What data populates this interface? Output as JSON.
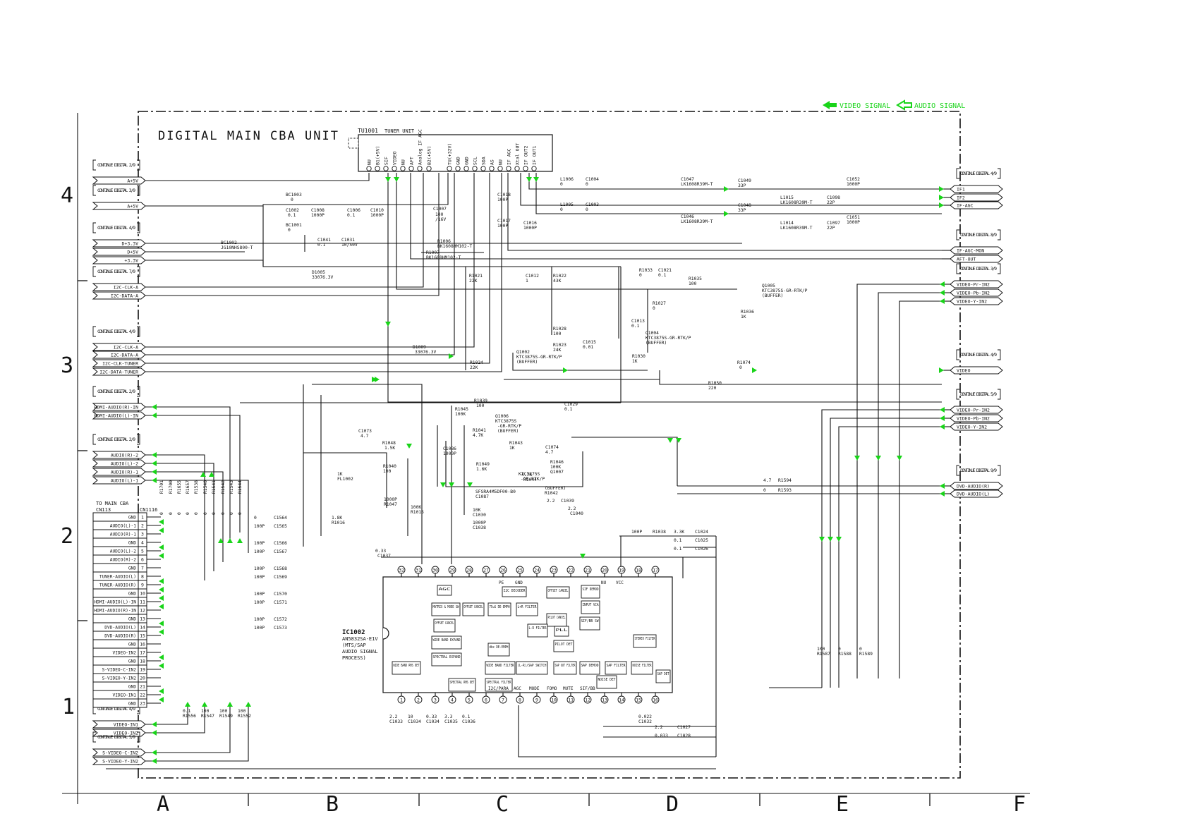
{
  "header": {
    "title": "DIGITAL MAIN CBA UNIT",
    "legend_video": "VIDEO SIGNAL",
    "legend_audio": "AUDIO SIGNAL"
  },
  "colors": {
    "signal_arrow": "#19d419",
    "line": "#111111"
  },
  "grid": {
    "columns": [
      "A",
      "B",
      "C",
      "D",
      "E",
      "F"
    ],
    "rows": [
      "4",
      "3",
      "2",
      "1"
    ]
  },
  "tuner": {
    "ref": "TU1001",
    "name": "TUNER UNIT",
    "pins": [
      "NU",
      "B1(+5V)",
      "SIF",
      "VIDEO",
      "NU",
      "AFT",
      "Analog IF AGC",
      "B2(+5V)",
      "TU(+32V)",
      "GND",
      "GND",
      "SCL",
      "SDA",
      "AS",
      "NU",
      "IF AGC",
      "Xtal OUT",
      "IF OUT2",
      "IF OUT1"
    ]
  },
  "left_connectors": [
    {
      "cont": "CONTINUE DIGITAL 2/9",
      "labels": [
        "A+5V"
      ]
    },
    {
      "cont": "CONTINUE DIGITAL 3/9",
      "labels": [
        "A+5V"
      ]
    },
    {
      "cont": "CONTINUE DIGITAL 4/9",
      "labels": [
        "D+3.3V",
        "D+5V",
        "+3.3V"
      ]
    },
    {
      "cont": "CONTINUE DIGITAL 7/9",
      "labels": [
        "I2C-CLK-A",
        "I2C-DATA-A"
      ]
    },
    {
      "cont": "CONTINUE DIGITAL 4/9",
      "labels": [
        "I2C-CLK-A",
        "I2C-DATA-A",
        "I2C-CLK-TUNER",
        "I2C-DATA-TUNER"
      ]
    },
    {
      "cont": "CONTINUE DIGITAL 2/9",
      "labels": [
        "HDMI-AUDIO(R)-IN",
        "HDMI-AUDIO(L)-IN"
      ]
    },
    {
      "cont": "CONTINUE DIGITAL 2/9",
      "labels": [
        "AUDIO(R)-2",
        "AUDIO(L)-2",
        "AUDIO(R)-1",
        "AUDIO(L)-1"
      ]
    },
    {
      "cont": "CONTINUE DIGITAL 4/9",
      "labels": [
        "VIDEO-IN1",
        "VIDEO-IN2"
      ]
    },
    {
      "cont": "CONTINUE DIGITAL 5/9",
      "labels": [
        "S-VIDEO-C-IN2",
        "S-VIDEO-Y-IN2"
      ]
    }
  ],
  "right_connectors": [
    {
      "cont": "CONTINUE DIGITAL 4/9",
      "labels": [
        "IF1",
        "IF2",
        "IF-AGC"
      ]
    },
    {
      "cont": "CONTINUE DIGITAL 8/9",
      "labels": [
        "IF-AGC-MON",
        "AFT-OUT"
      ]
    },
    {
      "cont": "CONTINUE DIGITAL 3/9",
      "labels": [
        "VIDEO-Pr-IN2",
        "VIDEO-Pb-IN2",
        "VIDEO-Y-IN2"
      ]
    },
    {
      "cont": "CONTINUE DIGITAL 4/9",
      "labels": [
        "VIDEO"
      ]
    },
    {
      "cont": "CONTINUE DIGITAL 5/9",
      "labels": [
        "VIDEO-Pr-IN2",
        "VIDEO-Pb-IN2",
        "VIDEO-Y-IN2"
      ]
    },
    {
      "cont": "CONTINUE DIGITAL 9/9",
      "labels": [
        "DVD-AUDIO(R)",
        "DVD-AUDIO(L)"
      ]
    }
  ],
  "io_connector": {
    "title": "TO MAIN CBA",
    "ref": "CN113",
    "ref2": "CN1116",
    "pins": [
      "GND",
      "AUDIO(L)-1",
      "AUDIO(R)-1",
      "GND",
      "AUDIO(L)-2",
      "AUDIO(R)-2",
      "GND",
      "TUNER-AUDIO(L)",
      "TUNER-AUDIO(R)",
      "GND",
      "HDMI-AUDIO(L)-IN",
      "HDMI-AUDIO(R)-IN",
      "GND",
      "DVD-AUDIO(L)",
      "DVD-AUDIO(R)",
      "GND",
      "VIDEO-IN2",
      "GND",
      "S-VIDEO-C-IN2",
      "S-VIDEO-Y-IN2",
      "GND",
      "VIDEO-IN1",
      "GND"
    ]
  },
  "ic": {
    "ref": "IC1002",
    "part": "AN5832SA-E1V",
    "function": [
      "(MTS/SAP",
      "AUDIO SIGNAL",
      "PROCESS)"
    ],
    "top_pins": [
      "32",
      "31",
      "30",
      "29",
      "28",
      "27",
      "26",
      "25",
      "24",
      "23",
      "22",
      "21",
      "20",
      "19",
      "18",
      "17"
    ],
    "bottom_pins": [
      "1",
      "2",
      "3",
      "4",
      "5",
      "6",
      "7",
      "8",
      "9",
      "10",
      "11",
      "12",
      "13",
      "14",
      "15",
      "16"
    ],
    "top_labels": [
      "PE",
      "GND",
      "NU",
      "VCC"
    ],
    "bottom_labels": [
      "I2C/PARA",
      "AGC",
      "MODE",
      "FOMO",
      "MUTE",
      "SIF/BB"
    ],
    "blocks": [
      "AGC",
      "MATRIX & MODE SW",
      "OFFSET CANCEL",
      "75uS DE-EMPH",
      "I2C DECODER",
      "L+R FILTER",
      "OFFSET CANCEL",
      "SIF DEMOD",
      "INPUT VCA",
      "SIF/BB SW",
      "PILOT CANCEL",
      "L-R FILTER",
      "PLL",
      "PILOT DET",
      "STEREO FILTER",
      "OFFSET CANCEL",
      "WIDE BAND EXPAND",
      "SPECTRAL EXPAND",
      "dbx DE-EMPH",
      "WIDE BAND RMS DET",
      "WIDE BAND FILTER",
      "(L-R)/SAP SWITCH",
      "SAP OUT FILTER",
      "SAP DEMOD",
      "SAP FILTER",
      "NOISE FILTER",
      "SAP DET",
      "SPECTRAL RMS DET",
      "SPECTRAL FILTER",
      "NOISE DET"
    ]
  },
  "components": [
    "BC1003",
    "0",
    "C1002",
    "0.1",
    "C1008",
    "1000P",
    "C1006",
    "0.1",
    "C1010",
    "1000P",
    "C1007",
    "100",
    "/16V",
    "BC1001",
    "0",
    "C1041",
    "0.1",
    "C1031",
    "10/50V",
    "BC1002",
    "JG10NHS800-T",
    "R1006",
    "BK1608HM102-T",
    "R1007",
    "BK1608HM102-T",
    "C1018",
    "100P",
    "C1017",
    "100P",
    "C1016",
    "1000P",
    "L1006",
    "0",
    "C1004",
    "0",
    "L1005",
    "0",
    "C1003",
    "0",
    "C1047",
    "LK1608R39M-T",
    "C1049",
    "33P",
    "C1048",
    "33P",
    "C1046",
    "LK1608R39M-T",
    "L1015",
    "LK1608R39M-T",
    "L1014",
    "LK1608R39M-T",
    "C1052",
    "1000P",
    "C1098",
    "22P",
    "C1097",
    "22P",
    "C1051",
    "1000P",
    "D1005",
    "33076.3V",
    "R1021",
    "22K",
    "C1012",
    "1",
    "R1022",
    "43K",
    "R1033",
    "0",
    "C1021",
    "0.1",
    "R1035",
    "100",
    "Q1005",
    "KTC3875S-GR-RTK/P",
    "(BUFFER)",
    "R1036",
    "1K",
    "R1027",
    "0",
    "C1013",
    "0.1",
    "Q1004",
    "KTC3875S-GR-RTK/P",
    "(BUFFER)",
    "R1028",
    "100",
    "R1023",
    "24K",
    "C1015",
    "0.01",
    "R1030",
    "1K",
    "D1009",
    "33076.3V",
    "Q1002",
    "KTC3875S-GR-RTK/P",
    "(BUFFER)",
    "R1024",
    "22K",
    "R1074",
    "0",
    "R1050",
    "220",
    "R1039",
    "100",
    "C1029",
    "0.1",
    "R1045",
    "100K",
    "Q1006",
    "KTC3875S",
    "-GR-RTK/P",
    "(BUFFER)",
    "R1041",
    "4.7K",
    "C1073",
    "4.7",
    "R1048",
    "1.5K",
    "C1086",
    "1000P",
    "R1043",
    "1K",
    "C1074",
    "4.7",
    "R1040",
    "100",
    "R1049",
    "1.6K",
    "R1046",
    "100K",
    "Q1007",
    "KTC3875S",
    "-GR-RTK/P",
    "(BUFFER)",
    "R1042",
    "4.7K",
    "R1044",
    "1K",
    "FL1002",
    "SFSRA4M5DF00-B0",
    "C1087",
    "1000P",
    "R1047",
    "100K",
    "R1015",
    "1.8K",
    "R1016",
    "10K",
    "C1030",
    "1000P",
    "C1038",
    "2.2",
    "C1039",
    "2.2",
    "C1040",
    "4.7",
    "R1594",
    "0",
    "R1593",
    "0",
    "R1701",
    "0",
    "R1700",
    "0",
    "R1655",
    "0",
    "R1657",
    "0",
    "R1538",
    "0",
    "R1540",
    "0",
    "R1541",
    "0",
    "R1542",
    "0",
    "R1543",
    "0",
    "R1544",
    "0",
    "C1564",
    "100P",
    "C1565",
    "100P",
    "C1566",
    "100P",
    "C1567",
    "100P",
    "C1568",
    "100P",
    "C1569",
    "100P",
    "C1570",
    "100P",
    "C1571",
    "100P",
    "C1572",
    "100P",
    "C1573",
    "100P",
    "R1038",
    "3.3K",
    "C1024",
    "0.1",
    "C1025",
    "0.1",
    "C1026",
    "0.33",
    "C1037",
    "2.2",
    "C1033",
    "10",
    "C1034",
    "0.33",
    "C1034",
    "3.3",
    "C1035",
    "0.1",
    "C1036",
    "0.022",
    "C1032",
    "2.2",
    "C1027",
    "0.033",
    "C1028",
    "0.1",
    "R1556",
    "100",
    "R1547",
    "100",
    "R1549",
    "100",
    "R1552",
    "100",
    "R1587",
    "0",
    "R1588",
    "0",
    "R1589",
    "0"
  ]
}
